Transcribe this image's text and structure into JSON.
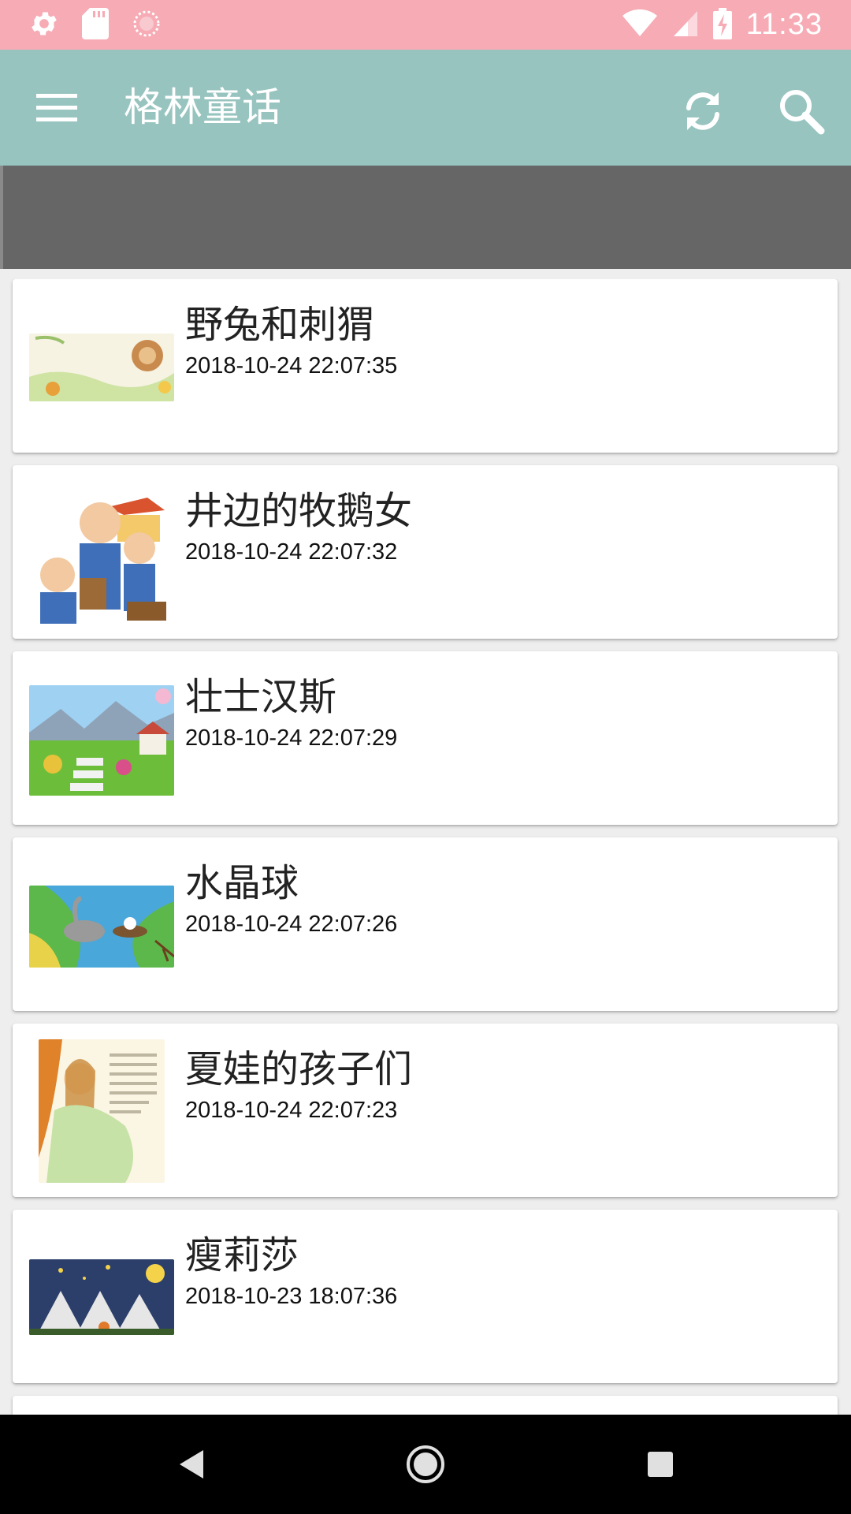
{
  "status_bar": {
    "time": "11:33",
    "left_icons": [
      "gear-icon",
      "sd-card-icon",
      "sync-circle-icon"
    ],
    "right_icons": [
      "wifi-icon",
      "cell-signal-icon",
      "battery-charging-icon"
    ]
  },
  "app_bar": {
    "title": "格林童话",
    "actions": [
      "refresh-icon",
      "search-icon"
    ]
  },
  "stories": [
    {
      "title": "野兔和刺猬",
      "date": "2018-10-24 22:07:35"
    },
    {
      "title": "井边的牧鹅女",
      "date": "2018-10-24 22:07:32"
    },
    {
      "title": "壮士汉斯",
      "date": "2018-10-24 22:07:29"
    },
    {
      "title": "水晶球",
      "date": "2018-10-24 22:07:26"
    },
    {
      "title": "夏娃的孩子们",
      "date": "2018-10-24 22:07:23"
    },
    {
      "title": "瘦莉莎",
      "date": "2018-10-23 18:07:36"
    }
  ],
  "nav_bar": {
    "buttons": [
      "back-icon",
      "home-icon",
      "recents-icon"
    ]
  },
  "colors": {
    "status_bar": "#f6abb5",
    "app_bar": "#97c4bf",
    "banner": "#666666",
    "background": "#eeeeee"
  }
}
